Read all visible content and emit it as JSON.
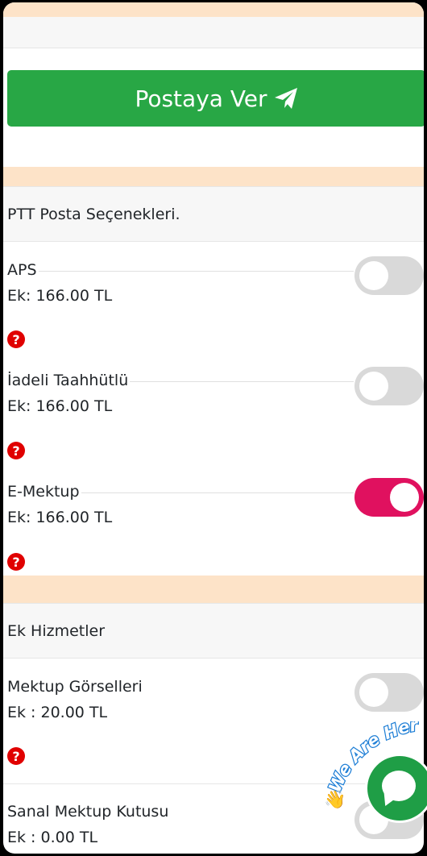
{
  "post_button": {
    "label": "Postaya Ver"
  },
  "sections": [
    {
      "title": "PTT Posta Seçenekleri."
    },
    {
      "title": "Ek Hizmetler"
    }
  ],
  "ptt_options": [
    {
      "title": "APS",
      "price": "Ek: 166.00 TL",
      "enabled": false
    },
    {
      "title": "İadeli Taahhütlü",
      "price": "Ek: 166.00 TL",
      "enabled": false
    },
    {
      "title": "E-Mektup",
      "price": "Ek: 166.00 TL",
      "enabled": true
    }
  ],
  "extra_services": [
    {
      "title": "Mektup Görselleri",
      "price": "Ek : 20.00 TL",
      "enabled": false
    },
    {
      "title": "Sanal Mektup Kutusu",
      "price": "Ek : 0.00 TL",
      "enabled": false
    }
  ],
  "help_symbol": "?",
  "chat_widget": {
    "tagline": "We Are Here",
    "icon": "chat-bubble-icon"
  },
  "colors": {
    "primary_button": "#28a745",
    "toggle_on": "#e0115f",
    "toggle_off": "#d9d9d9",
    "help_icon": "#e00000",
    "section_band": "#fde3c8",
    "chat": "#1f9e46"
  }
}
